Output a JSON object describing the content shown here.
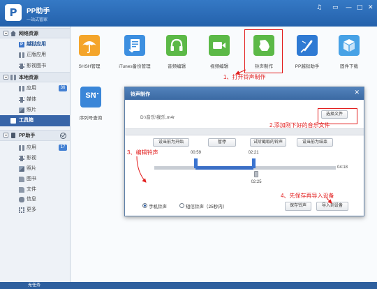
{
  "window": {
    "logo_text": "P",
    "title": "PP助手",
    "subtitle": "一站式管家"
  },
  "titlebar": {
    "icons": [
      "music-note-icon",
      "screen-icon",
      "minimize-icon",
      "maximize-icon",
      "close-icon"
    ]
  },
  "sidebar": {
    "network": {
      "header": "网络资源",
      "items": [
        {
          "label": "越狱应用",
          "icon": "pp-icon",
          "selected": true
        },
        {
          "label": "正版应用",
          "icon": "apps-icon"
        },
        {
          "label": "影视图书",
          "icon": "film-icon"
        }
      ]
    },
    "local": {
      "header": "本地资源",
      "items": [
        {
          "label": "应用",
          "icon": "apps-icon",
          "badge": "36"
        },
        {
          "label": "媒体",
          "icon": "media-icon"
        },
        {
          "label": "照片",
          "icon": "photo-icon"
        }
      ]
    },
    "toolbox": {
      "label": "工具箱",
      "icon": "toolbox-icon",
      "selected": true
    },
    "device": {
      "header": "PP助手",
      "items": [
        {
          "label": "应用",
          "icon": "apps-icon",
          "badge": "17"
        },
        {
          "label": "影视",
          "icon": "film-icon"
        },
        {
          "label": "照片",
          "icon": "photo-icon"
        },
        {
          "label": "图书",
          "icon": "book-icon"
        },
        {
          "label": "文件",
          "icon": "file-icon"
        },
        {
          "label": "信息",
          "icon": "message-icon"
        },
        {
          "label": "更多",
          "icon": "more-icon"
        }
      ]
    }
  },
  "tools": [
    {
      "label": "SHSH管理",
      "icon": "umbrella-icon",
      "color": "#f4a52b"
    },
    {
      "label": "iTunes备份管理",
      "icon": "backup-document-icon",
      "color": "#3d8fe0"
    },
    {
      "label": "音频编辑",
      "icon": "headphones-icon",
      "color": "#5cb947"
    },
    {
      "label": "视频编辑",
      "icon": "video-camera-icon",
      "color": "#5cb947"
    },
    {
      "label": "铃声制作",
      "icon": "ringtone-icon",
      "color": "#5cb947"
    },
    {
      "label": "PP越狱助手",
      "icon": "jailbreak-icon",
      "color": "#2f7ad3"
    },
    {
      "label": "固件下载",
      "icon": "cube-icon",
      "color": "#47a2e6"
    },
    {
      "label": "序列号查询",
      "icon": "sn-icon",
      "icon_text": "SN",
      "color": "#3a86d8"
    }
  ],
  "dialog": {
    "title": "铃声制作",
    "file_path": "D:\\音乐\\我乐.m4r",
    "select_file_button": "选择文件",
    "buttons": [
      "设当前为开始",
      "暂停",
      "试听截取的铃声",
      "设当前为结束"
    ],
    "start_time": "00:59",
    "end_time": "02:21",
    "current_time": "02:25",
    "total_time": "04:18",
    "ringtone_types": [
      {
        "label": "手机铃声",
        "selected": true
      },
      {
        "label": "短信铃声（25秒内）",
        "selected": false
      }
    ],
    "save_button": "保存铃声",
    "import_button": "导入到设备"
  },
  "annotations": [
    "1、打开铃声制作",
    "2.添加刚下好的音乐文件",
    "3、编辑铃声",
    "4、先保存再导入设备"
  ],
  "status": {
    "text": "无任务"
  },
  "colors": {
    "titlebar": "#2c6cba",
    "sidebar_selected": "#3865a8",
    "annotation": "#e21c1c",
    "track_selected": "#3b6fc6"
  }
}
